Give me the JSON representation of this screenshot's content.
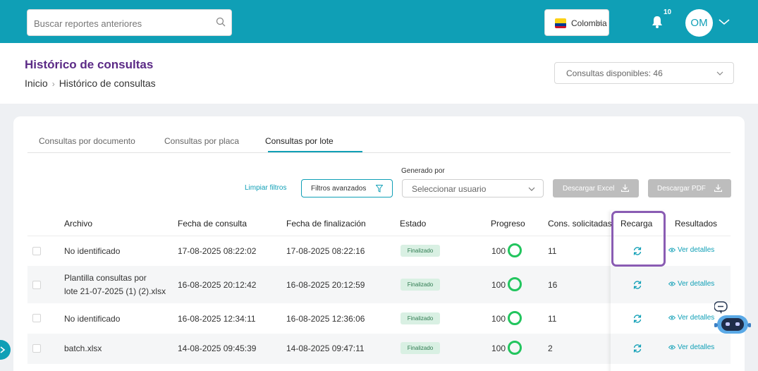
{
  "topbar": {
    "search_placeholder": "Buscar reportes anteriores",
    "country": "Colombia",
    "notification_count": "10",
    "avatar_initials": "OM"
  },
  "header": {
    "title": "Histórico de consultas",
    "breadcrumb": [
      "Inicio",
      "Histórico de consultas"
    ],
    "quota_label": "Consultas disponibles: 46"
  },
  "tabs": [
    {
      "label": "Consultas por documento",
      "active": false
    },
    {
      "label": "Consultas por placa",
      "active": false
    },
    {
      "label": "Consultas por lote",
      "active": true
    }
  ],
  "filters": {
    "clear": "Limpiar filtros",
    "advanced": "Filtros avanzados",
    "generated_by_label": "Generado por",
    "user_select_placeholder": "Seleccionar usuario",
    "download_excel": "Descargar Excel",
    "download_pdf": "Descargar PDF"
  },
  "table": {
    "headers": [
      "Archivo",
      "Fecha de consulta",
      "Fecha de finalización",
      "Estado",
      "Progreso",
      "Cons. solicitadas",
      "Recarga",
      "Resultados"
    ],
    "rows": [
      {
        "file": "No identificado",
        "file2": "",
        "query_date": "17-08-2025 08:22:02",
        "end_date": "17-08-2025 08:22:16",
        "status": "Finalizado",
        "progress": "100",
        "requested": "11",
        "details": "Ver detalles"
      },
      {
        "file": "Plantilla consultas por",
        "file2": "lote 21-07-2025 (1) (2).xlsx",
        "query_date": "16-08-2025 20:12:42",
        "end_date": "16-08-2025 20:12:59",
        "status": "Finalizado",
        "progress": "100",
        "requested": "16",
        "details": "Ver detalles"
      },
      {
        "file": "No identificado",
        "file2": "",
        "query_date": "16-08-2025 12:34:11",
        "end_date": "16-08-2025 12:36:06",
        "status": "Finalizado",
        "progress": "100",
        "requested": "11",
        "details": "Ver detalles"
      },
      {
        "file": "batch.xlsx",
        "file2": "",
        "query_date": "14-08-2025 09:45:39",
        "end_date": "14-08-2025 09:47:11",
        "status": "Finalizado",
        "progress": "100",
        "requested": "2",
        "details": "Ver detalles"
      }
    ]
  },
  "colors": {
    "brand": "#0f9fb6",
    "title": "#5b2a86",
    "highlight": "#8a5cb3",
    "progress": "#22c55e"
  }
}
